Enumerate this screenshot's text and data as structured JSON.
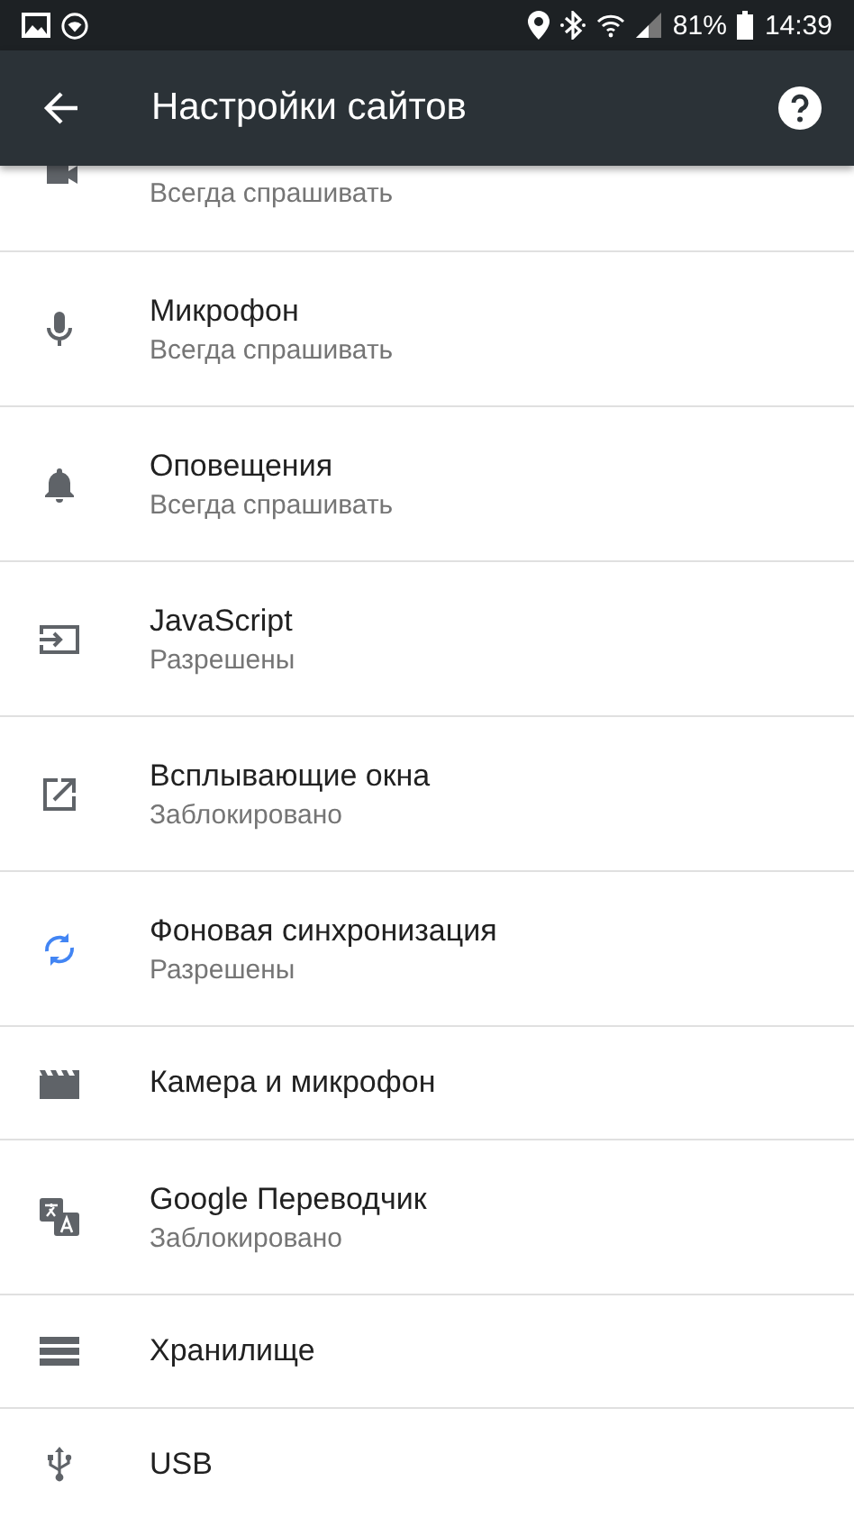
{
  "status_bar": {
    "battery_text": "81%",
    "time": "14:39"
  },
  "toolbar": {
    "title": "Настройки сайтов"
  },
  "items": [
    {
      "kind": "partial",
      "subtitle": "Всегда спрашивать",
      "color": "#5f6368"
    },
    {
      "kind": "two-line",
      "title": "Микрофон",
      "subtitle": "Всегда спрашивать",
      "color": "#5f6368"
    },
    {
      "kind": "two-line",
      "title": "Оповещения",
      "subtitle": "Всегда спрашивать",
      "color": "#5f6368"
    },
    {
      "kind": "two-line",
      "title": "JavaScript",
      "subtitle": "Разрешены",
      "color": "#5f6368"
    },
    {
      "kind": "two-line",
      "title": "Всплывающие окна",
      "subtitle": "Заблокировано",
      "color": "#5f6368"
    },
    {
      "kind": "two-line",
      "title": "Фоновая синхронизация",
      "subtitle": "Разрешены",
      "color": "#4285f4"
    },
    {
      "kind": "one-line",
      "title": "Камера и микрофон",
      "color": "#5f6368"
    },
    {
      "kind": "two-line",
      "title": "Google Переводчик",
      "subtitle": "Заблокировано",
      "color": "#5f6368"
    },
    {
      "kind": "one-line",
      "title": "Хранилище",
      "color": "#5f6368"
    },
    {
      "kind": "one-line",
      "title": "USB",
      "color": "#5f6368"
    }
  ]
}
